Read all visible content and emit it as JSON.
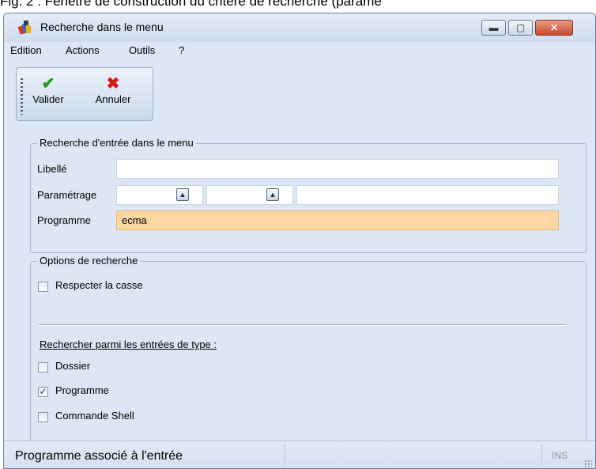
{
  "caption": "Fig. 2 : Fenêtre de construction du critère de recherche (paramè",
  "window": {
    "title": "Recherche dans le menu",
    "controls": {
      "minimize": "▬",
      "maximize": "▢",
      "close": "✕"
    }
  },
  "menu": [
    "Edition",
    "Actions",
    "Outils",
    "?"
  ],
  "toolbar": {
    "validate_label": "Valider",
    "cancel_label": "Annuler",
    "validate_glyph": "✔",
    "cancel_glyph": "✖"
  },
  "search_group": {
    "legend": "Recherche d'entrée dans le menu",
    "libelle": {
      "label": "Libellé",
      "value": ""
    },
    "parametrage": {
      "label": "Paramétrage",
      "value1": "",
      "value2": "",
      "value3": "",
      "spin_glyph": "▲"
    },
    "programme": {
      "label": "Programme",
      "value": "ecma"
    }
  },
  "options_group": {
    "legend": "Options de recherche",
    "match_case": {
      "label": "Respecter la casse",
      "checked": false
    },
    "type_heading": "Rechercher parmi les entrées de type :",
    "types": [
      {
        "label": "Dossier",
        "checked": false,
        "mark": ""
      },
      {
        "label": "Programme",
        "checked": true,
        "mark": "✓"
      },
      {
        "label": "Commande Shell",
        "checked": false,
        "mark": ""
      }
    ]
  },
  "status": {
    "message": "Programme associé à l'entrée",
    "mode": "INS"
  },
  "colors": {
    "window_bg": "#dce6f4",
    "programme_field_bg": "#fcd7a4",
    "validate": "#1f9b1f",
    "cancel": "#d11b0e"
  },
  "icons": {
    "app": "app-books-icon",
    "validate": "checkmark-icon",
    "cancel": "cross-icon"
  }
}
